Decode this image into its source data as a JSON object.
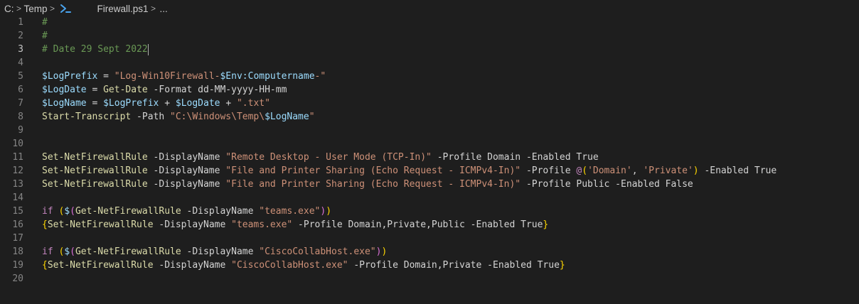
{
  "breadcrumb": {
    "drive": "C:",
    "folder": "Temp",
    "file": "Firewall.ps1",
    "more": "...",
    "icon": "powershell-icon",
    "chevron": ">"
  },
  "editor": {
    "language": "PowerShell",
    "active_line": 3,
    "lines": [
      {
        "n": "1",
        "tokens": [
          {
            "t": "#",
            "c": "comment"
          }
        ]
      },
      {
        "n": "2",
        "tokens": [
          {
            "t": "#",
            "c": "comment"
          }
        ]
      },
      {
        "n": "3",
        "tokens": [
          {
            "t": "# Date 29 Sept 2022",
            "c": "comment"
          }
        ],
        "cursor": true
      },
      {
        "n": "4",
        "tokens": []
      },
      {
        "n": "5",
        "tokens": [
          {
            "t": "$LogPrefix",
            "c": "var"
          },
          {
            "t": " = ",
            "c": "op"
          },
          {
            "t": "\"Log-Win10Firewall-",
            "c": "str"
          },
          {
            "t": "$Env:Computername",
            "c": "var"
          },
          {
            "t": "-\"",
            "c": "str"
          }
        ]
      },
      {
        "n": "6",
        "tokens": [
          {
            "t": "$LogDate",
            "c": "var"
          },
          {
            "t": " = ",
            "c": "op"
          },
          {
            "t": "Get-Date",
            "c": "cmd"
          },
          {
            "t": " -Format dd-MM-yyyy-HH-mm",
            "c": "param"
          }
        ]
      },
      {
        "n": "7",
        "tokens": [
          {
            "t": "$LogName",
            "c": "var"
          },
          {
            "t": " = ",
            "c": "op"
          },
          {
            "t": "$LogPrefix",
            "c": "var"
          },
          {
            "t": " + ",
            "c": "op"
          },
          {
            "t": "$LogDate",
            "c": "var"
          },
          {
            "t": " + ",
            "c": "op"
          },
          {
            "t": "\".txt\"",
            "c": "str"
          }
        ]
      },
      {
        "n": "8",
        "tokens": [
          {
            "t": "Start-Transcript",
            "c": "cmd"
          },
          {
            "t": " -Path ",
            "c": "param"
          },
          {
            "t": "\"C:\\Windows\\Temp\\",
            "c": "str"
          },
          {
            "t": "$LogName",
            "c": "var"
          },
          {
            "t": "\"",
            "c": "str"
          }
        ]
      },
      {
        "n": "9",
        "tokens": []
      },
      {
        "n": "10",
        "tokens": []
      },
      {
        "n": "11",
        "tokens": [
          {
            "t": "Set-NetFirewallRule",
            "c": "cmd"
          },
          {
            "t": " -DisplayName ",
            "c": "param"
          },
          {
            "t": "\"Remote Desktop - User Mode (TCP-In)\"",
            "c": "str"
          },
          {
            "t": " -Profile Domain -Enabled True",
            "c": "param"
          }
        ]
      },
      {
        "n": "12",
        "tokens": [
          {
            "t": "Set-NetFirewallRule",
            "c": "cmd"
          },
          {
            "t": " -DisplayName ",
            "c": "param"
          },
          {
            "t": "\"File and Printer Sharing (Echo Request - ICMPv4-In)\"",
            "c": "str"
          },
          {
            "t": " -Profile ",
            "c": "param"
          },
          {
            "t": "@",
            "c": "kw"
          },
          {
            "t": "(",
            "c": "br1"
          },
          {
            "t": "'Domain'",
            "c": "str"
          },
          {
            "t": ", ",
            "c": "op"
          },
          {
            "t": "'Private'",
            "c": "str"
          },
          {
            "t": ")",
            "c": "br1"
          },
          {
            "t": " -Enabled True",
            "c": "param"
          }
        ]
      },
      {
        "n": "13",
        "tokens": [
          {
            "t": "Set-NetFirewallRule",
            "c": "cmd"
          },
          {
            "t": " -DisplayName ",
            "c": "param"
          },
          {
            "t": "\"File and Printer Sharing (Echo Request - ICMPv4-In)\"",
            "c": "str"
          },
          {
            "t": " -Profile Public -Enabled False",
            "c": "param"
          }
        ]
      },
      {
        "n": "14",
        "tokens": []
      },
      {
        "n": "15",
        "tokens": [
          {
            "t": "if",
            "c": "kw"
          },
          {
            "t": " ",
            "c": "op"
          },
          {
            "t": "(",
            "c": "br1"
          },
          {
            "t": "$",
            "c": "var"
          },
          {
            "t": "(",
            "c": "br2"
          },
          {
            "t": "Get-NetFirewallRule",
            "c": "cmd"
          },
          {
            "t": " -DisplayName ",
            "c": "param"
          },
          {
            "t": "\"teams.exe\"",
            "c": "str"
          },
          {
            "t": ")",
            "c": "br2"
          },
          {
            "t": ")",
            "c": "br1"
          }
        ]
      },
      {
        "n": "16",
        "tokens": [
          {
            "t": "{",
            "c": "br1"
          },
          {
            "t": "Set-NetFirewallRule",
            "c": "cmd"
          },
          {
            "t": " -DisplayName ",
            "c": "param"
          },
          {
            "t": "\"teams.exe\"",
            "c": "str"
          },
          {
            "t": " -Profile Domain,Private,Public -Enabled True",
            "c": "param"
          },
          {
            "t": "}",
            "c": "br1"
          }
        ]
      },
      {
        "n": "17",
        "tokens": []
      },
      {
        "n": "18",
        "tokens": [
          {
            "t": "if",
            "c": "kw"
          },
          {
            "t": " ",
            "c": "op"
          },
          {
            "t": "(",
            "c": "br1"
          },
          {
            "t": "$",
            "c": "var"
          },
          {
            "t": "(",
            "c": "br2"
          },
          {
            "t": "Get-NetFirewallRule",
            "c": "cmd"
          },
          {
            "t": " -DisplayName ",
            "c": "param"
          },
          {
            "t": "\"CiscoCollabHost.exe\"",
            "c": "str"
          },
          {
            "t": ")",
            "c": "br2"
          },
          {
            "t": ")",
            "c": "br1"
          }
        ]
      },
      {
        "n": "19",
        "tokens": [
          {
            "t": "{",
            "c": "br1"
          },
          {
            "t": "Set-NetFirewallRule",
            "c": "cmd"
          },
          {
            "t": " -DisplayName ",
            "c": "param"
          },
          {
            "t": "\"CiscoCollabHost.exe\"",
            "c": "str"
          },
          {
            "t": " -Profile Domain,Private -Enabled True",
            "c": "param"
          },
          {
            "t": "}",
            "c": "br1"
          }
        ]
      },
      {
        "n": "20",
        "tokens": []
      }
    ]
  },
  "colors": {
    "background": "#1e1e1e",
    "comment": "#6a9955",
    "variable": "#9cdcfe",
    "string": "#ce9178",
    "command": "#dcdcaa",
    "keyword": "#c586c0",
    "bracket_level1": "#ffd700",
    "bracket_level2": "#da70d6",
    "line_number": "#858585"
  }
}
